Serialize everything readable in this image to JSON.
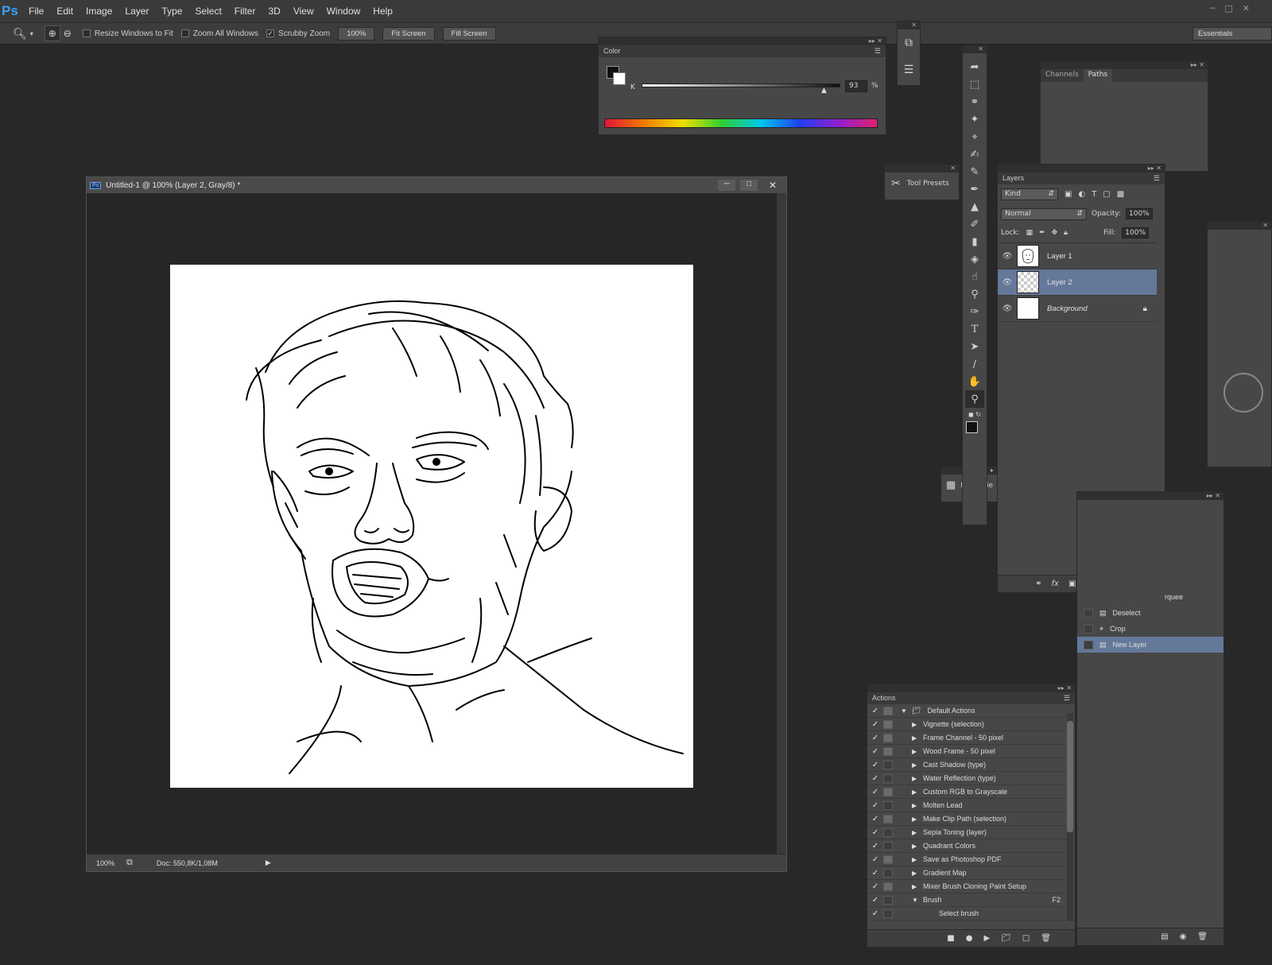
{
  "app": {
    "logo": "Ps"
  },
  "menu": [
    "File",
    "Edit",
    "Image",
    "Layer",
    "Type",
    "Select",
    "Filter",
    "3D",
    "View",
    "Window",
    "Help"
  ],
  "options": {
    "resize_windows": "Resize Windows to Fit",
    "zoom_all": "Zoom All Windows",
    "scrubby_zoom": "Scrubby Zoom",
    "zoom_value": "100%",
    "fit_screen": "Fit Screen",
    "fill_screen": "Fill Screen",
    "workspace": "Essentials"
  },
  "color_panel": {
    "title": "Color",
    "channel": "K",
    "value": "93",
    "unit": "%"
  },
  "tool_presets": {
    "label": "Tool Presets"
  },
  "properties": {
    "label": "Propertie"
  },
  "channels_panel": {
    "tab1": "Channels",
    "tab2": "Paths"
  },
  "document": {
    "title": "Untitled-1 @ 100% (Layer 2, Gray/8) *",
    "zoom": "100%",
    "doc_info": "Doc: 550,8K/1,08M"
  },
  "layers_panel": {
    "title": "Layers",
    "kind": "Kind",
    "blend": "Normal",
    "opacity_label": "Opacity:",
    "opacity": "100%",
    "lock_label": "Lock:",
    "fill_label": "Fill:",
    "fill": "100%",
    "layers": [
      {
        "name": "Layer 1"
      },
      {
        "name": "Layer 2"
      },
      {
        "name": "Background"
      }
    ]
  },
  "history_panel": {
    "items": [
      {
        "label": "rquee"
      },
      {
        "label": "Deselect"
      },
      {
        "label": "Crop"
      },
      {
        "label": "New Layer"
      }
    ]
  },
  "actions_panel": {
    "title": "Actions",
    "set": "Default Actions",
    "items": [
      {
        "label": "Vignette (selection)",
        "key": ""
      },
      {
        "label": "Frame Channel - 50 pixel",
        "key": ""
      },
      {
        "label": "Wood Frame - 50 pixel",
        "key": ""
      },
      {
        "label": "Cast Shadow (type)",
        "key": ""
      },
      {
        "label": "Water Reflection (type)",
        "key": ""
      },
      {
        "label": "Custom RGB to Grayscale",
        "key": ""
      },
      {
        "label": "Molten Lead",
        "key": ""
      },
      {
        "label": "Make Clip Path (selection)",
        "key": ""
      },
      {
        "label": "Sepia Toning (layer)",
        "key": ""
      },
      {
        "label": "Quadrant Colors",
        "key": ""
      },
      {
        "label": "Save as Photoshop PDF",
        "key": ""
      },
      {
        "label": "Gradient Map",
        "key": ""
      },
      {
        "label": "Mixer Brush Cloning Paint Setup",
        "key": ""
      },
      {
        "label": "Brush",
        "key": "F2"
      }
    ],
    "sub_item": "Select brush"
  }
}
